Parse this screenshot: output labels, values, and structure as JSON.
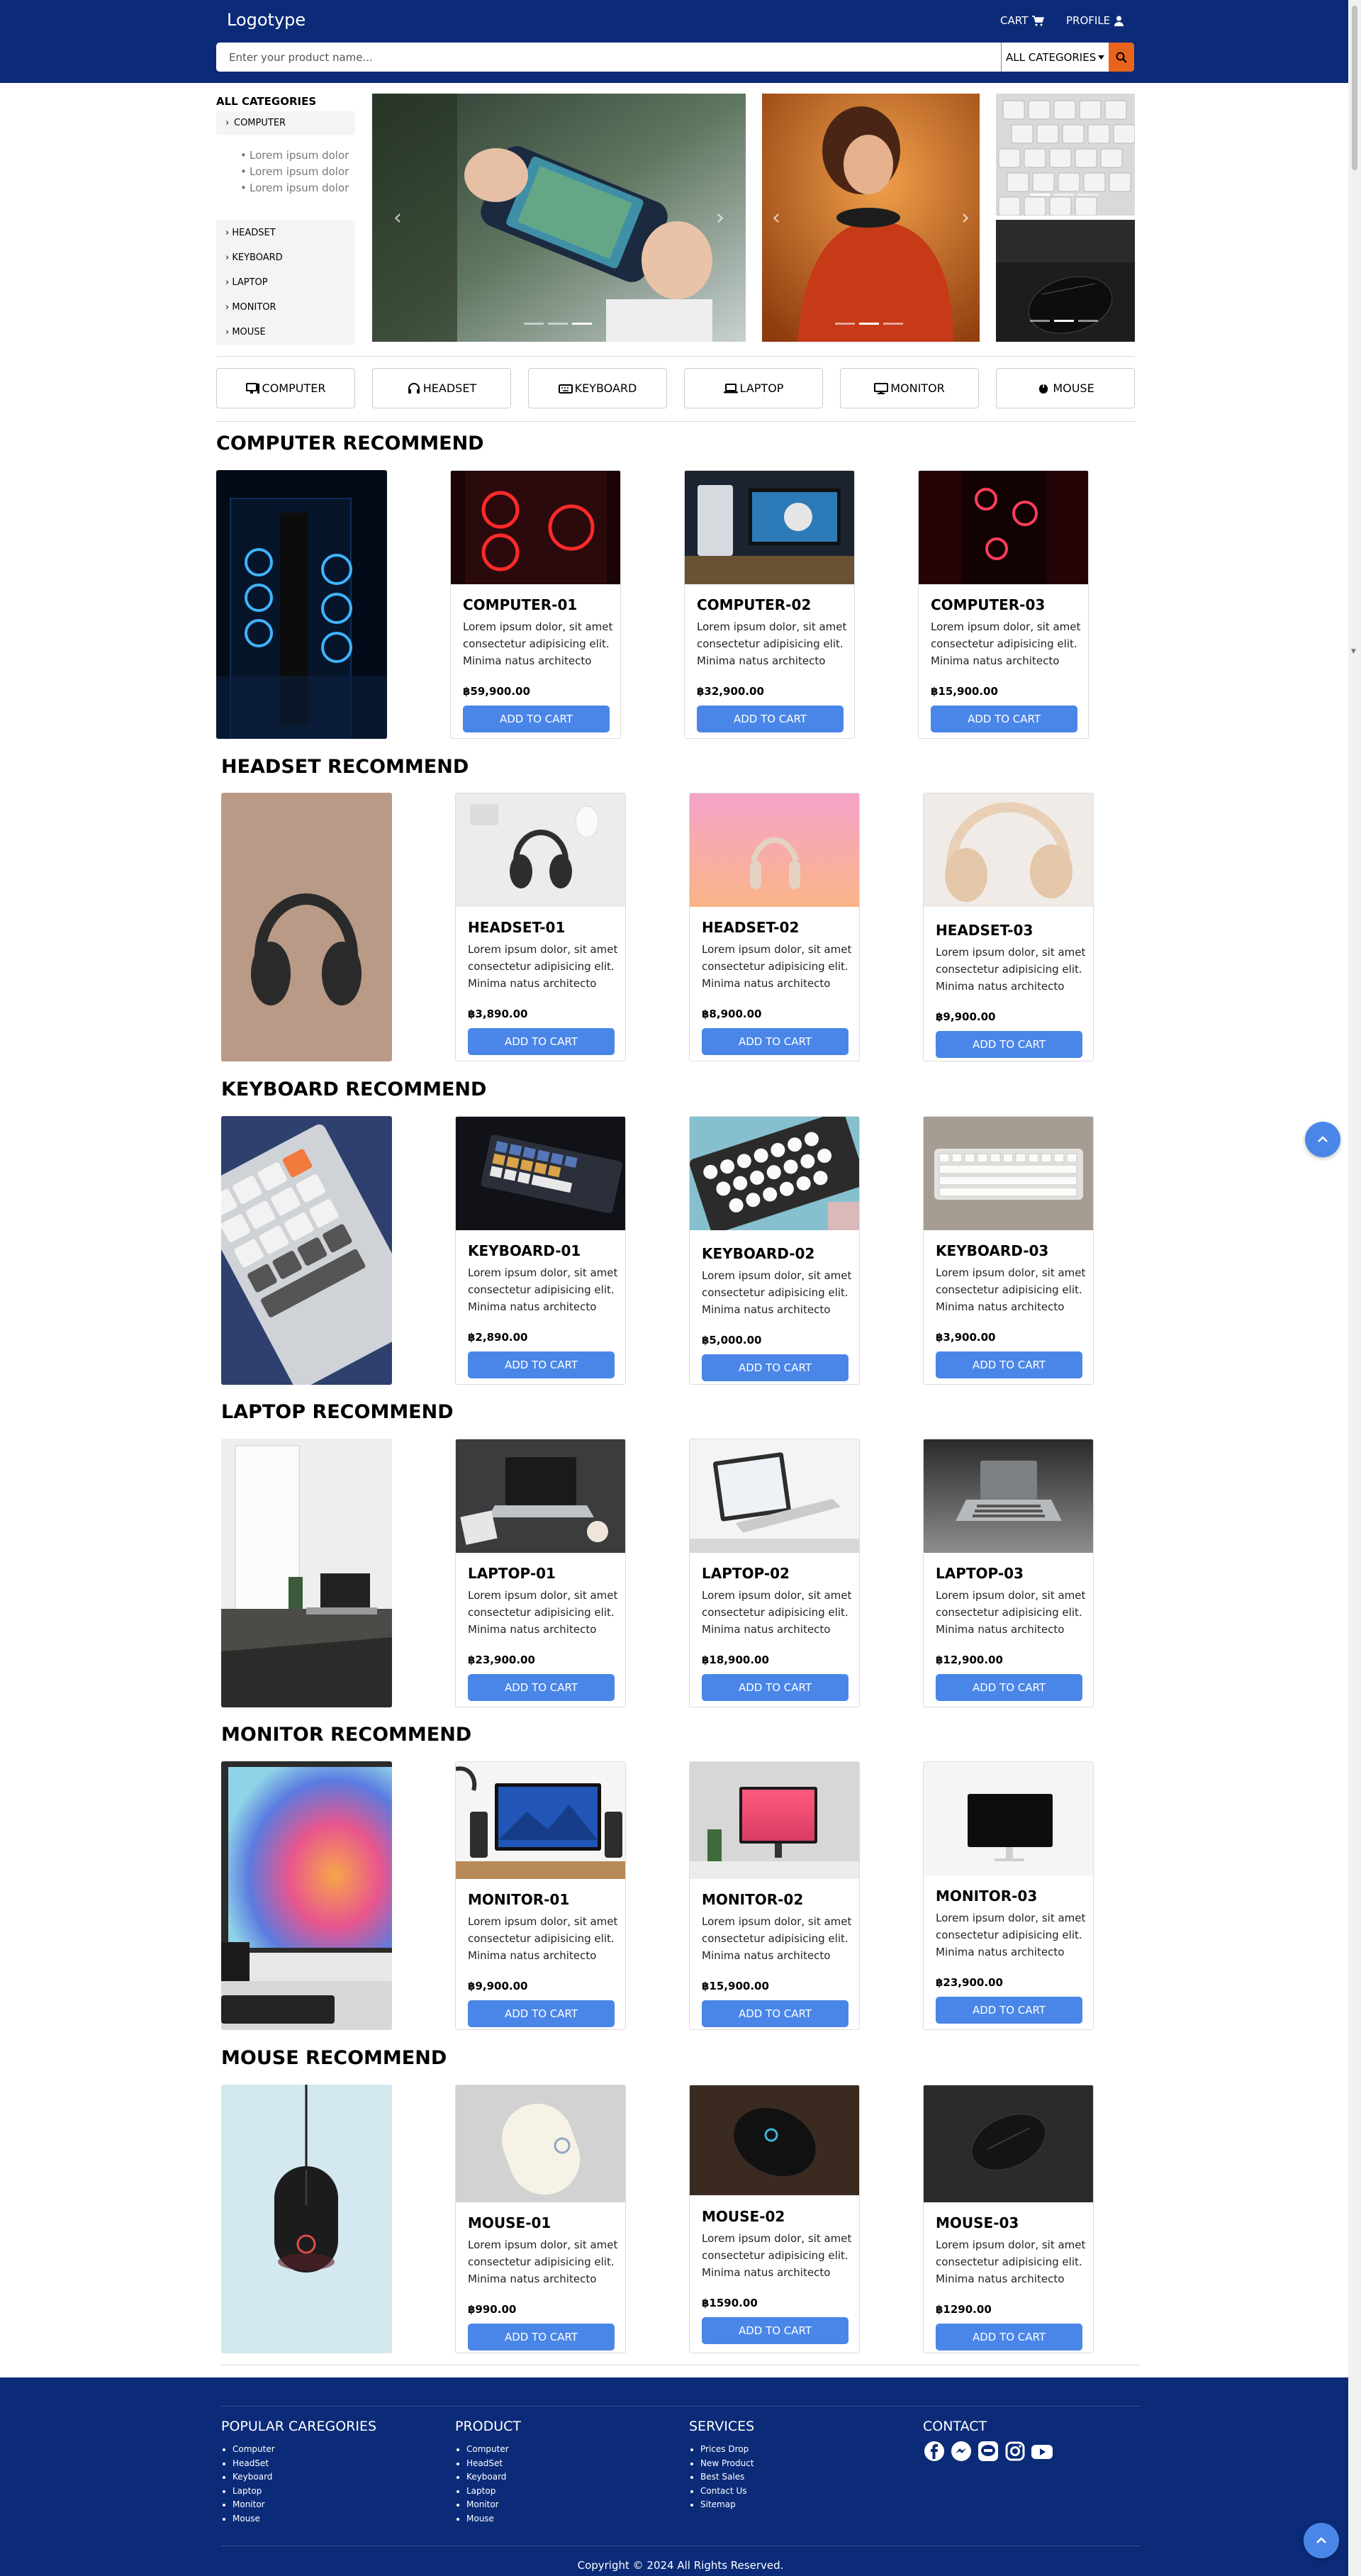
{
  "header": {
    "logo": "Logotype",
    "cart_label": "CART",
    "profile_label": "PROFILE",
    "search_placeholder": "Enter your product name...",
    "category_select": "ALL CATEGORIES"
  },
  "sidebar": {
    "title": "ALL CATEGORIES",
    "expanded_item": "COMPUTER",
    "sub_items": [
      "Lorem ipsum dolor",
      "Lorem ipsum dolor",
      "Lorem ipsum dolor"
    ],
    "items": [
      "HEADSET",
      "KEYBOARD",
      "LAPTOP",
      "MONITOR",
      "MOUSE"
    ]
  },
  "category_buttons": [
    "COMPUTER",
    "HEADSET",
    "KEYBOARD",
    "LAPTOP",
    "MONITOR",
    "MOUSE"
  ],
  "sections": [
    {
      "title": "COMPUTER RECOMMEND",
      "products": [
        {
          "name": "COMPUTER-01",
          "desc": "Lorem ipsum dolor, sit amet consectetur adipisicing elit. Minima natus architecto",
          "price": "฿59,900.00",
          "button": "ADD TO CART"
        },
        {
          "name": "COMPUTER-02",
          "desc": "Lorem ipsum dolor, sit amet consectetur adipisicing elit. Minima natus architecto",
          "price": "฿32,900.00",
          "button": "ADD TO CART"
        },
        {
          "name": "COMPUTER-03",
          "desc": "Lorem ipsum dolor, sit amet consectetur adipisicing elit. Minima natus architecto",
          "price": "฿15,900.00",
          "button": "ADD TO CART"
        }
      ]
    },
    {
      "title": "HEADSET RECOMMEND",
      "products": [
        {
          "name": "HEADSET-01",
          "desc": "Lorem ipsum dolor, sit amet consectetur adipisicing elit. Minima natus architecto",
          "price": "฿3,890.00",
          "button": "ADD TO CART"
        },
        {
          "name": "HEADSET-02",
          "desc": "Lorem ipsum dolor, sit amet consectetur adipisicing elit. Minima natus architecto",
          "price": "฿8,900.00",
          "button": "ADD TO CART"
        },
        {
          "name": "HEADSET-03",
          "desc": "Lorem ipsum dolor, sit amet consectetur adipisicing elit. Minima natus architecto",
          "price": "฿9,900.00",
          "button": "ADD TO CART"
        }
      ]
    },
    {
      "title": "KEYBOARD RECOMMEND",
      "products": [
        {
          "name": "KEYBOARD-01",
          "desc": "Lorem ipsum dolor, sit amet consectetur adipisicing elit. Minima natus architecto",
          "price": "฿2,890.00",
          "button": "ADD TO CART"
        },
        {
          "name": "KEYBOARD-02",
          "desc": "Lorem ipsum dolor, sit amet consectetur adipisicing elit. Minima natus architecto",
          "price": "฿5,000.00",
          "button": "ADD TO CART"
        },
        {
          "name": "KEYBOARD-03",
          "desc": "Lorem ipsum dolor, sit amet consectetur adipisicing elit. Minima natus architecto",
          "price": "฿3,900.00",
          "button": "ADD TO CART"
        }
      ]
    },
    {
      "title": "LAPTOP RECOMMEND",
      "products": [
        {
          "name": "LAPTOP-01",
          "desc": "Lorem ipsum dolor, sit amet consectetur adipisicing elit. Minima natus architecto",
          "price": "฿23,900.00",
          "button": "ADD TO CART"
        },
        {
          "name": "LAPTOP-02",
          "desc": "Lorem ipsum dolor, sit amet consectetur adipisicing elit. Minima natus architecto",
          "price": "฿18,900.00",
          "button": "ADD TO CART"
        },
        {
          "name": "LAPTOP-03",
          "desc": "Lorem ipsum dolor, sit amet consectetur adipisicing elit. Minima natus architecto",
          "price": "฿12,900.00",
          "button": "ADD TO CART"
        }
      ]
    },
    {
      "title": "MONITOR RECOMMEND",
      "products": [
        {
          "name": "MONITOR-01",
          "desc": "Lorem ipsum dolor, sit amet consectetur adipisicing elit. Minima natus architecto",
          "price": "฿9,900.00",
          "button": "ADD TO CART"
        },
        {
          "name": "MONITOR-02",
          "desc": "Lorem ipsum dolor, sit amet consectetur adipisicing elit. Minima natus architecto",
          "price": "฿15,900.00",
          "button": "ADD TO CART"
        },
        {
          "name": "MONITOR-03",
          "desc": "Lorem ipsum dolor, sit amet consectetur adipisicing elit. Minima natus architecto",
          "price": "฿23,900.00",
          "button": "ADD TO CART"
        }
      ]
    },
    {
      "title": "MOUSE RECOMMEND",
      "products": [
        {
          "name": "MOUSE-01",
          "desc": "Lorem ipsum dolor, sit amet consectetur adipisicing elit. Minima natus architecto",
          "price": "฿990.00",
          "button": "ADD TO CART"
        },
        {
          "name": "MOUSE-02",
          "desc": "Lorem ipsum dolor, sit amet consectetur adipisicing elit. Minima natus architecto",
          "price": "฿1590.00",
          "button": "ADD TO CART"
        },
        {
          "name": "MOUSE-03",
          "desc": "Lorem ipsum dolor, sit amet consectetur adipisicing elit. Minima natus architecto",
          "price": "฿1290.00",
          "button": "ADD TO CART"
        }
      ]
    }
  ],
  "footer": {
    "columns": [
      {
        "title": "POPULAR CAREGORIES",
        "items": [
          "Computer",
          "HeadSet",
          "Keyboard",
          "Laptop",
          "Monitor",
          "Mouse"
        ]
      },
      {
        "title": "PRODUCT",
        "items": [
          "Computer",
          "HeadSet",
          "Keyboard",
          "Laptop",
          "Monitor",
          "Mouse"
        ]
      },
      {
        "title": "SERVICES",
        "items": [
          "Prices Drop",
          "New Product",
          "Best Sales",
          "Contact Us",
          "Sitemap"
        ]
      }
    ],
    "contact_title": "CONTACT",
    "social_icons": [
      "facebook-icon",
      "messenger-icon",
      "line-icon",
      "instagram-icon",
      "youtube-icon"
    ],
    "copyright": "Copyright © 2024 All Rights Reserved."
  },
  "colors": {
    "header_bg": "#0b2b78",
    "accent_orange": "#e8641c",
    "button_blue": "#4a86e8"
  }
}
